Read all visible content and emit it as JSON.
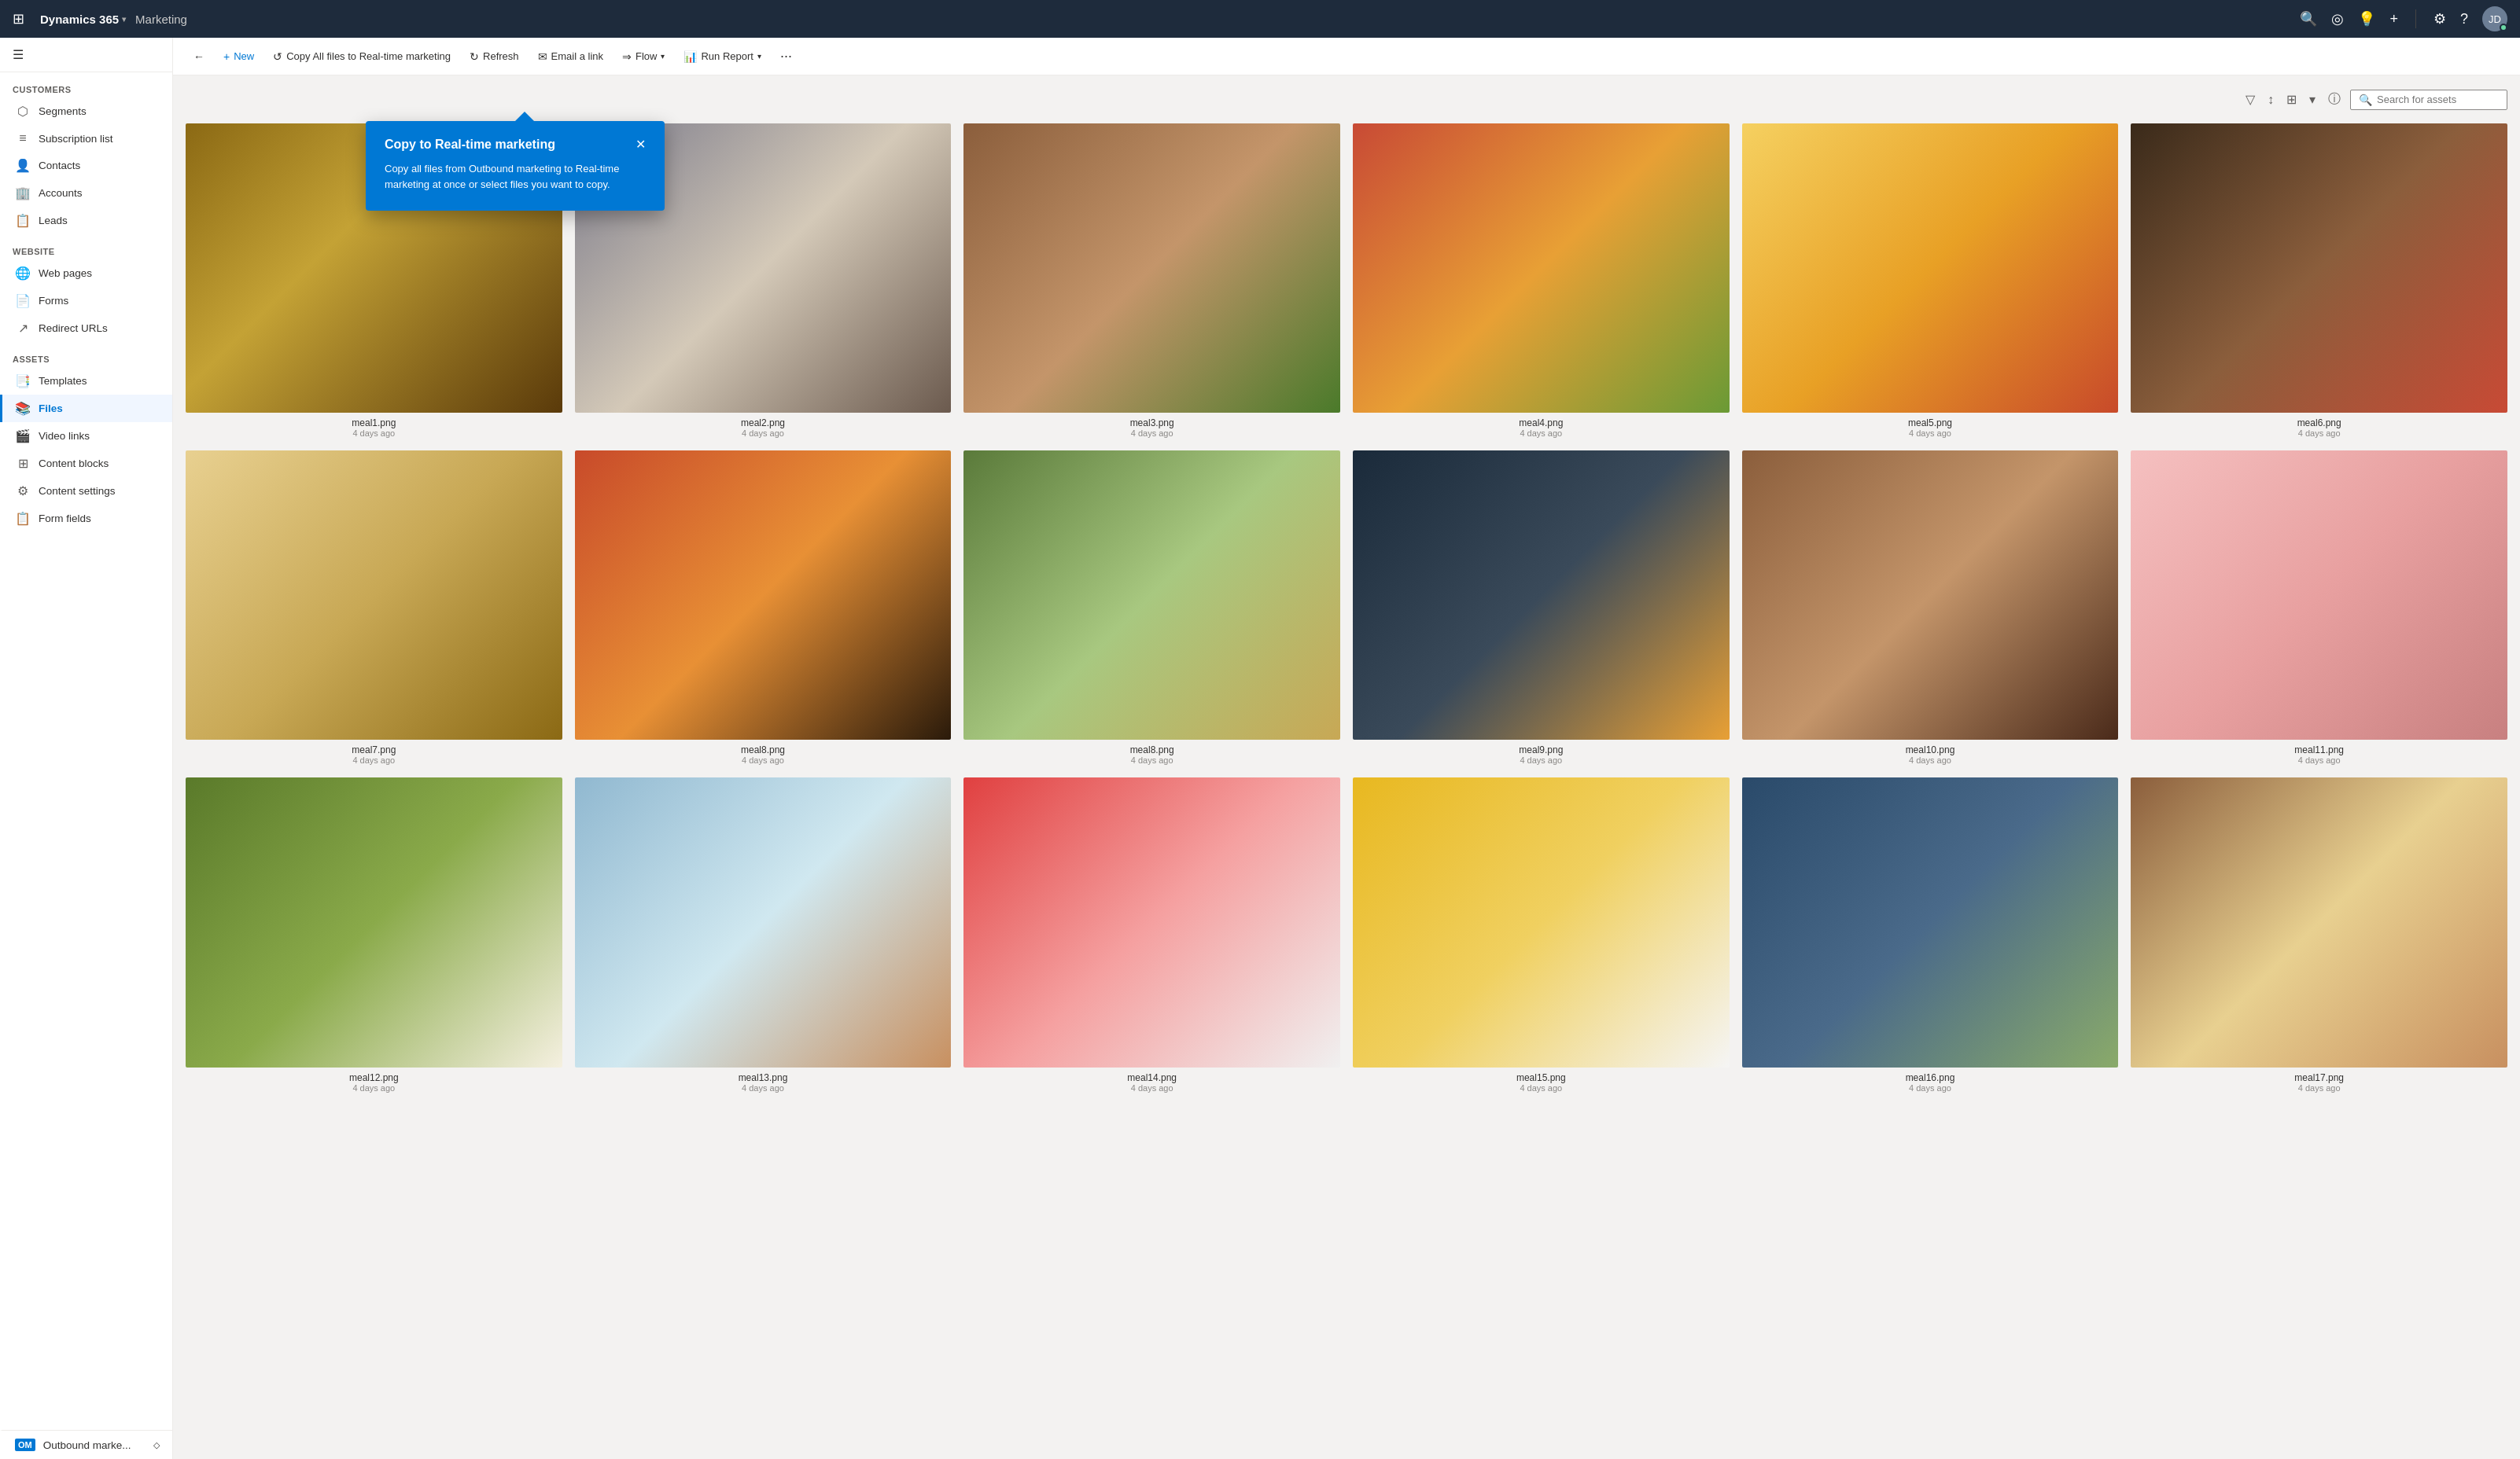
{
  "topbar": {
    "waffle_icon": "⊞",
    "brand": "Dynamics 365",
    "chevron": "▾",
    "module": "Marketing",
    "icons": {
      "search": "🔍",
      "target": "◎",
      "lightbulb": "💡",
      "plus": "+",
      "gear": "⚙",
      "question": "?"
    },
    "avatar_initials": "JD"
  },
  "sidebar": {
    "hamburger": "☰",
    "sections": [
      {
        "label": "Customers",
        "items": [
          {
            "id": "segments",
            "icon": "⬡",
            "label": "Segments"
          },
          {
            "id": "subscription-list",
            "icon": "☰",
            "label": "Subscription list"
          },
          {
            "id": "contacts",
            "icon": "👤",
            "label": "Contacts"
          },
          {
            "id": "accounts",
            "icon": "🏢",
            "label": "Accounts"
          },
          {
            "id": "leads",
            "icon": "📋",
            "label": "Leads"
          }
        ]
      },
      {
        "label": "Website",
        "items": [
          {
            "id": "web-pages",
            "icon": "🌐",
            "label": "Web pages"
          },
          {
            "id": "forms",
            "icon": "📄",
            "label": "Forms"
          },
          {
            "id": "redirect-urls",
            "icon": "↗",
            "label": "Redirect URLs"
          }
        ]
      },
      {
        "label": "Assets",
        "items": [
          {
            "id": "templates",
            "icon": "📑",
            "label": "Templates"
          },
          {
            "id": "files",
            "icon": "📚",
            "label": "Files",
            "active": true
          },
          {
            "id": "video-links",
            "icon": "🎬",
            "label": "Video links"
          },
          {
            "id": "content-blocks",
            "icon": "⊞",
            "label": "Content blocks"
          },
          {
            "id": "content-settings",
            "icon": "⚙",
            "label": "Content settings"
          },
          {
            "id": "form-fields",
            "icon": "📋",
            "label": "Form fields"
          }
        ]
      }
    ],
    "bottom": {
      "label": "Outbound marke...",
      "icon": "OM"
    }
  },
  "toolbar": {
    "back_label": "←",
    "new_label": "New",
    "copy_label": "Copy All files to Real-time marketing",
    "refresh_label": "Refresh",
    "email_label": "Email a link",
    "flow_label": "Flow",
    "run_report_label": "Run Report",
    "more_label": "···"
  },
  "files_toolbar": {
    "filter_icon": "▽",
    "sort_icon": "↕",
    "view_icon": "⊞",
    "view_chevron": "▾",
    "info_icon": "ⓘ",
    "search_placeholder": "Search for assets"
  },
  "popup": {
    "title": "Copy to Real-time marketing",
    "body": "Copy all files from Outbound marketing to Real-time marketing at once or select files you want to copy.",
    "close_label": "✕"
  },
  "files": [
    {
      "id": "meal1",
      "name": "meal1.png",
      "date": "4 days ago",
      "colorClass": "meal1"
    },
    {
      "id": "meal2",
      "name": "meal2.png",
      "date": "4 days ago",
      "colorClass": "meal2"
    },
    {
      "id": "meal3",
      "name": "meal3.png",
      "date": "4 days ago",
      "colorClass": "meal3"
    },
    {
      "id": "meal4",
      "name": "meal4.png",
      "date": "4 days ago",
      "colorClass": "meal4"
    },
    {
      "id": "meal5",
      "name": "meal5.png",
      "date": "4 days ago",
      "colorClass": "meal5"
    },
    {
      "id": "meal6",
      "name": "meal6.png",
      "date": "4 days ago",
      "colorClass": "meal6"
    },
    {
      "id": "meal7",
      "name": "meal7.png",
      "date": "4 days ago",
      "colorClass": "meal7"
    },
    {
      "id": "meal8a",
      "name": "meal8.png",
      "date": "4 days ago",
      "colorClass": "meal8a"
    },
    {
      "id": "meal8b",
      "name": "meal8.png",
      "date": "4 days ago",
      "colorClass": "meal8b"
    },
    {
      "id": "meal9",
      "name": "meal9.png",
      "date": "4 days ago",
      "colorClass": "meal9"
    },
    {
      "id": "meal10",
      "name": "meal10.png",
      "date": "4 days ago",
      "colorClass": "meal10"
    },
    {
      "id": "meal11",
      "name": "meal11.png",
      "date": "4 days ago",
      "colorClass": "meal11"
    },
    {
      "id": "meal12",
      "name": "meal12.png",
      "date": "4 days ago",
      "colorClass": "meal12"
    },
    {
      "id": "meal13",
      "name": "meal13.png",
      "date": "4 days ago",
      "colorClass": "meal13"
    },
    {
      "id": "meal14",
      "name": "meal14.png",
      "date": "4 days ago",
      "colorClass": "meal14"
    },
    {
      "id": "meal15",
      "name": "meal15.png",
      "date": "4 days ago",
      "colorClass": "meal15"
    },
    {
      "id": "meal16",
      "name": "meal16.png",
      "date": "4 days ago",
      "colorClass": "meal16"
    },
    {
      "id": "meal17",
      "name": "meal17.png",
      "date": "4 days ago",
      "colorClass": "meal17"
    }
  ]
}
